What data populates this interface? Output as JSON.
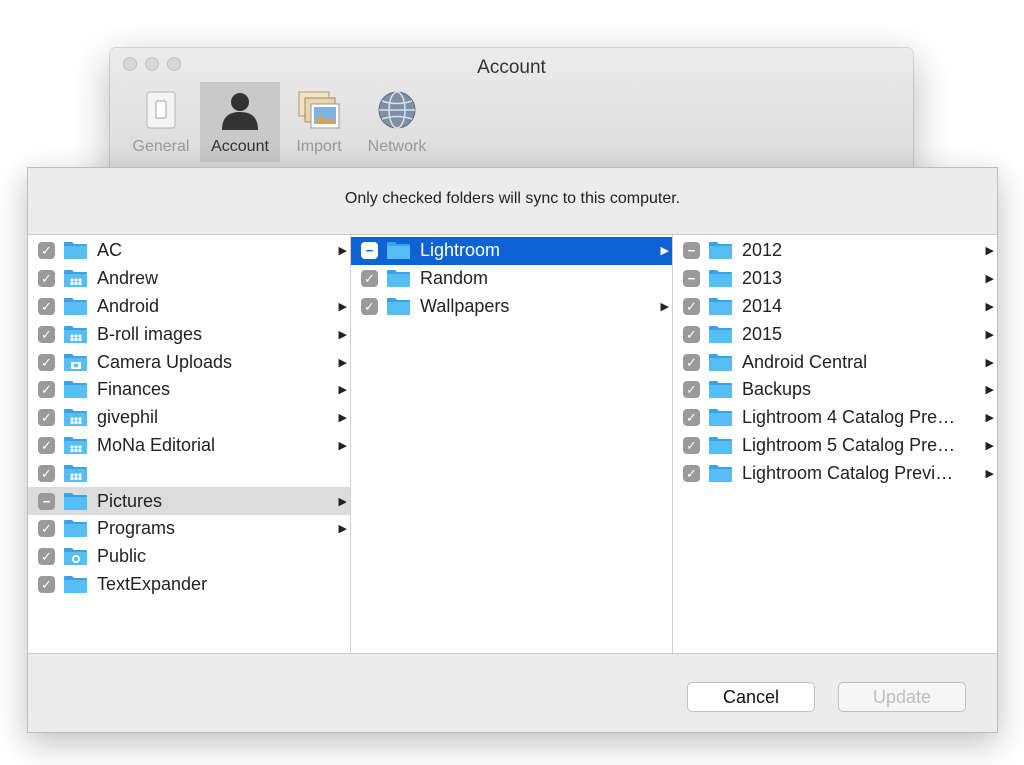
{
  "window": {
    "title": "Account",
    "toolbar": [
      {
        "label": "General",
        "icon": "general-switch-icon"
      },
      {
        "label": "Account",
        "icon": "account-person-icon",
        "active": true
      },
      {
        "label": "Import",
        "icon": "import-photos-icon"
      },
      {
        "label": "Network",
        "icon": "network-globe-icon"
      }
    ]
  },
  "sheet": {
    "message": "Only checked folders will sync to this computer.",
    "cancel_label": "Cancel",
    "update_label": "Update"
  },
  "columns": [
    [
      {
        "name": "AC",
        "check": "checked",
        "icon": "folder",
        "arrow": true
      },
      {
        "name": "Andrew",
        "check": "checked",
        "icon": "shared-folder",
        "arrow": false
      },
      {
        "name": "Android",
        "check": "checked",
        "icon": "folder",
        "arrow": true
      },
      {
        "name": "B-roll images",
        "check": "checked",
        "icon": "shared-folder",
        "arrow": true
      },
      {
        "name": "Camera Uploads",
        "check": "checked",
        "icon": "camera-folder",
        "arrow": true
      },
      {
        "name": "Finances",
        "check": "checked",
        "icon": "folder",
        "arrow": true
      },
      {
        "name": "givephil",
        "check": "checked",
        "icon": "shared-folder",
        "arrow": true
      },
      {
        "name": "MoNa Editorial",
        "check": "checked",
        "icon": "shared-folder",
        "arrow": true
      },
      {
        "name": "",
        "check": "checked",
        "icon": "shared-folder",
        "arrow": false
      },
      {
        "name": "Pictures",
        "check": "mixed",
        "icon": "folder",
        "arrow": true,
        "highlight": "gray"
      },
      {
        "name": "Programs",
        "check": "checked",
        "icon": "folder",
        "arrow": true
      },
      {
        "name": "Public",
        "check": "checked",
        "icon": "public-folder",
        "arrow": false
      },
      {
        "name": "TextExpander",
        "check": "checked",
        "icon": "folder",
        "arrow": false
      }
    ],
    [
      {
        "name": "Lightroom",
        "check": "mixed",
        "icon": "folder",
        "arrow": true,
        "highlight": "blue"
      },
      {
        "name": "Random",
        "check": "checked",
        "icon": "folder",
        "arrow": false
      },
      {
        "name": "Wallpapers",
        "check": "checked",
        "icon": "folder",
        "arrow": true
      }
    ],
    [
      {
        "name": "2012",
        "check": "mixed",
        "icon": "folder",
        "arrow": true
      },
      {
        "name": "2013",
        "check": "mixed",
        "icon": "folder",
        "arrow": true
      },
      {
        "name": "2014",
        "check": "checked",
        "icon": "folder",
        "arrow": true
      },
      {
        "name": "2015",
        "check": "checked",
        "icon": "folder",
        "arrow": true
      },
      {
        "name": "Android Central",
        "check": "checked",
        "icon": "folder",
        "arrow": true
      },
      {
        "name": "Backups",
        "check": "checked",
        "icon": "folder",
        "arrow": true
      },
      {
        "name": "Lightroom 4 Catalog Pre…",
        "check": "checked",
        "icon": "folder",
        "arrow": true
      },
      {
        "name": "Lightroom 5 Catalog Pre…",
        "check": "checked",
        "icon": "folder",
        "arrow": true
      },
      {
        "name": "Lightroom Catalog Previ…",
        "check": "checked",
        "icon": "folder",
        "arrow": true
      }
    ]
  ],
  "colors": {
    "selection_blue": "#0e62d4",
    "folder_blue": "#56bdf5",
    "checkbox_gray": "#9a9a9a"
  }
}
